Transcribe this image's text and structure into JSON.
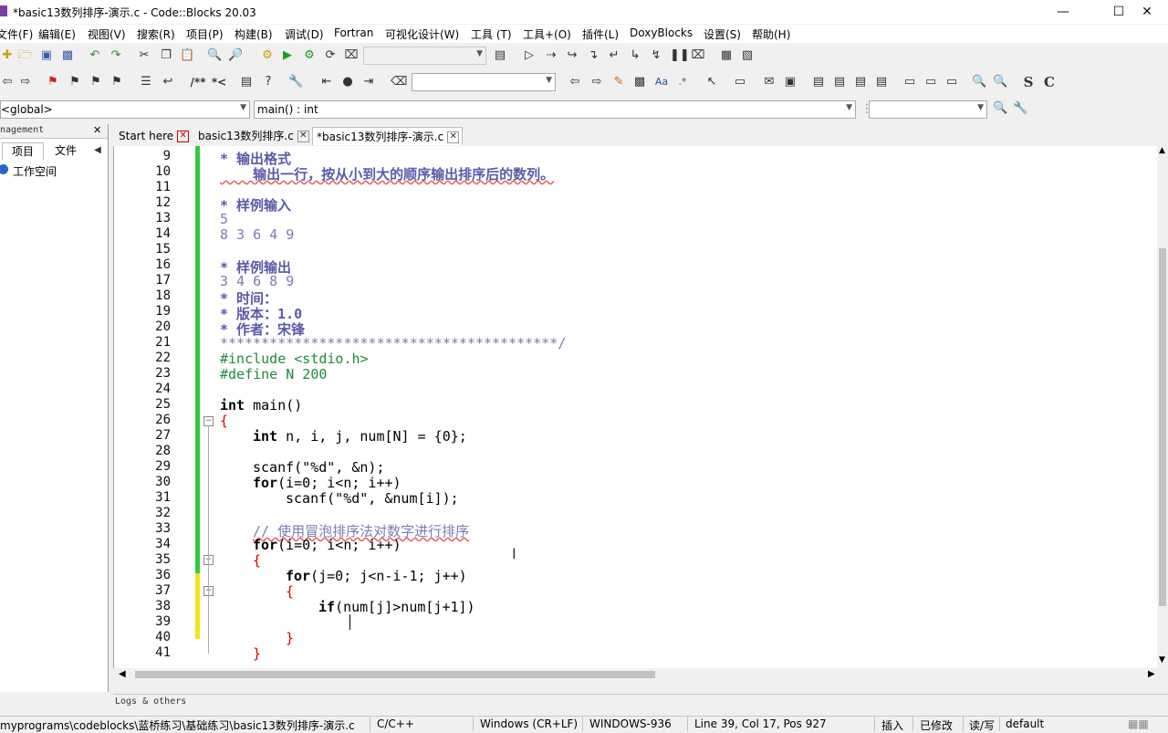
{
  "window": {
    "title": "*basic13数列排序-演示.c - Code::Blocks 20.03"
  },
  "menu": [
    "文件(F)",
    "编辑(E)",
    "视图(V)",
    "搜索(R)",
    "项目(P)",
    "构建(B)",
    "调试(D)",
    "Fortran",
    "可视化设计(W)",
    "工具 (T)",
    "工具+(O)",
    "插件(L)",
    "DoxyBlocks",
    "设置(S)",
    "帮助(H)"
  ],
  "scope": {
    "global": "<global>",
    "function": "main() : int"
  },
  "management": {
    "title": "nagement",
    "tabs": [
      "项目",
      "文件"
    ],
    "tree_item": "工作空间"
  },
  "editor_tabs": [
    "Start here",
    "basic13数列排序.c",
    "*basic13数列排序-演示.c"
  ],
  "code": {
    "line_numbers": [
      "9",
      "10",
      "11",
      "12",
      "13",
      "14",
      "15",
      "16",
      "17",
      "18",
      "19",
      "20",
      "21",
      "22",
      "23",
      "24",
      "25",
      "26",
      "27",
      "28",
      "29",
      "30",
      "31",
      "32",
      "33",
      "34",
      "35",
      "36",
      "37",
      "38",
      "39",
      "40",
      "41"
    ],
    "lines": {
      "l9": "* 输出格式",
      "l10": "    输出一行，按从小到大的顺序输出排序后的数列。",
      "l12": "* 样例输入",
      "l13": "5",
      "l14": "8 3 6 4 9",
      "l16": "* 样例输出",
      "l17": "3 4 6 8 9",
      "l18": "* 时间：",
      "l19": "* 版本：1.0",
      "l20": "* 作者：宋锋",
      "l21": "*****************************************/",
      "l22": "#include <stdio.h>",
      "l23": "#define N 200",
      "l25_kw": "int",
      "l25_rest": " main()",
      "l26": "{",
      "l27_kw": "int",
      "l27_rest": " n, i, j, num[N] = {0};",
      "l29": "scanf(\"%d\", &n);",
      "l30_kw": "for",
      "l30_rest": "(i=0; i<n; i++)",
      "l31": "scanf(\"%d\", &num[i]);",
      "l33": "// 使用冒泡排序法对数字进行排序",
      "l34_kw": "for",
      "l34_rest": "(i=0; i<n; i++)",
      "l35": "{",
      "l36_kw": "for",
      "l36_rest": "(j=0; j<n-i-1; j++)",
      "l37": "{",
      "l38_kw": "if",
      "l38_rest": "(num[j]>num[j+1])",
      "l40": "}",
      "l41": "}"
    }
  },
  "logs": {
    "title": "Logs & others"
  },
  "status": {
    "path": "myprograms\\codeblocks\\蓝桥练习\\基础练习\\basic13数列排序-演示.c",
    "language": "C/C++",
    "eol": "Windows (CR+LF)",
    "encoding": "WINDOWS-936",
    "position": "Line 39, Col 17, Pos 927",
    "mode": "插入",
    "modified": "已修改",
    "access": "读/写",
    "profile": "default"
  }
}
